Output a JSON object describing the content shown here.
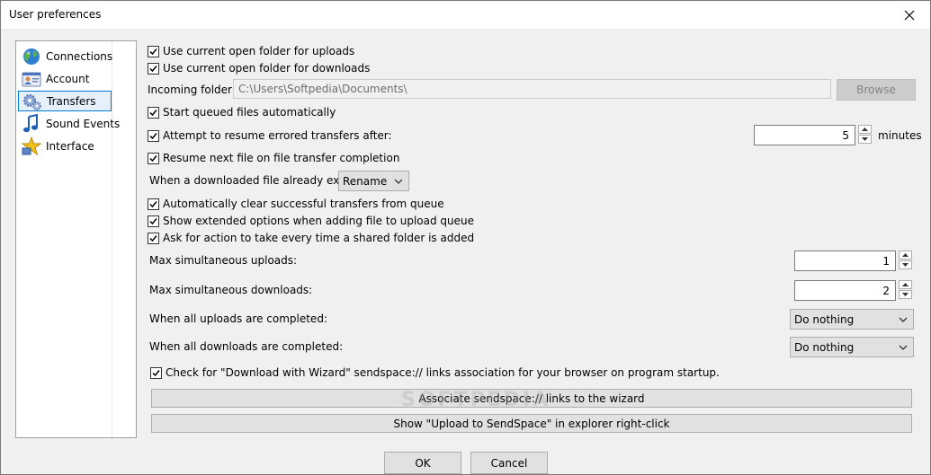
{
  "window": {
    "title": "User preferences"
  },
  "sidebar": {
    "items": [
      {
        "label": "Connections",
        "icon": "globe-icon"
      },
      {
        "label": "Account",
        "icon": "account-card-icon"
      },
      {
        "label": "Transfers",
        "icon": "gears-icon",
        "selected": true
      },
      {
        "label": "Sound Events",
        "icon": "music-note-icon"
      },
      {
        "label": "Interface",
        "icon": "interface-star-icon"
      }
    ]
  },
  "transfers": {
    "use_folder_uploads": "Use current open folder for uploads",
    "use_folder_downloads": "Use current open folder for downloads",
    "incoming_folder_label": "Incoming folder:",
    "incoming_folder_value": "C:\\Users\\Softpedia\\Documents\\",
    "browse_label": "Browse",
    "start_queued": "Start queued files automatically",
    "resume_errored": "Attempt to resume errored transfers after:",
    "resume_minutes_value": "5",
    "minutes_label": "minutes",
    "resume_next": "Resume next file on file transfer completion",
    "exists_label": "When a downloaded file already exists:",
    "exists_value": "Rename",
    "auto_clear": "Automatically clear successful transfers from queue",
    "show_extended": "Show extended options when adding file to upload queue",
    "ask_shared": "Ask for action to take every time a shared folder is added",
    "max_uploads_label": "Max simultaneous uploads:",
    "max_uploads_value": "1",
    "max_downloads_label": "Max simultaneous downloads:",
    "max_downloads_value": "2",
    "uploads_done_label": "When all uploads are completed:",
    "uploads_done_value": "Do nothing",
    "downloads_done_label": "When all downloads are completed:",
    "downloads_done_value": "Do nothing",
    "check_wizard": "Check for \"Download with Wizard\" sendspace:// links association for your browser on program startup.",
    "associate_button": "Associate sendspace:// links to the wizard",
    "show_upload_button": "Show \"Upload to SendSpace\" in explorer right-click"
  },
  "footer": {
    "ok_label": "OK",
    "cancel_label": "Cancel"
  },
  "watermark": "SOFTPEDIA"
}
